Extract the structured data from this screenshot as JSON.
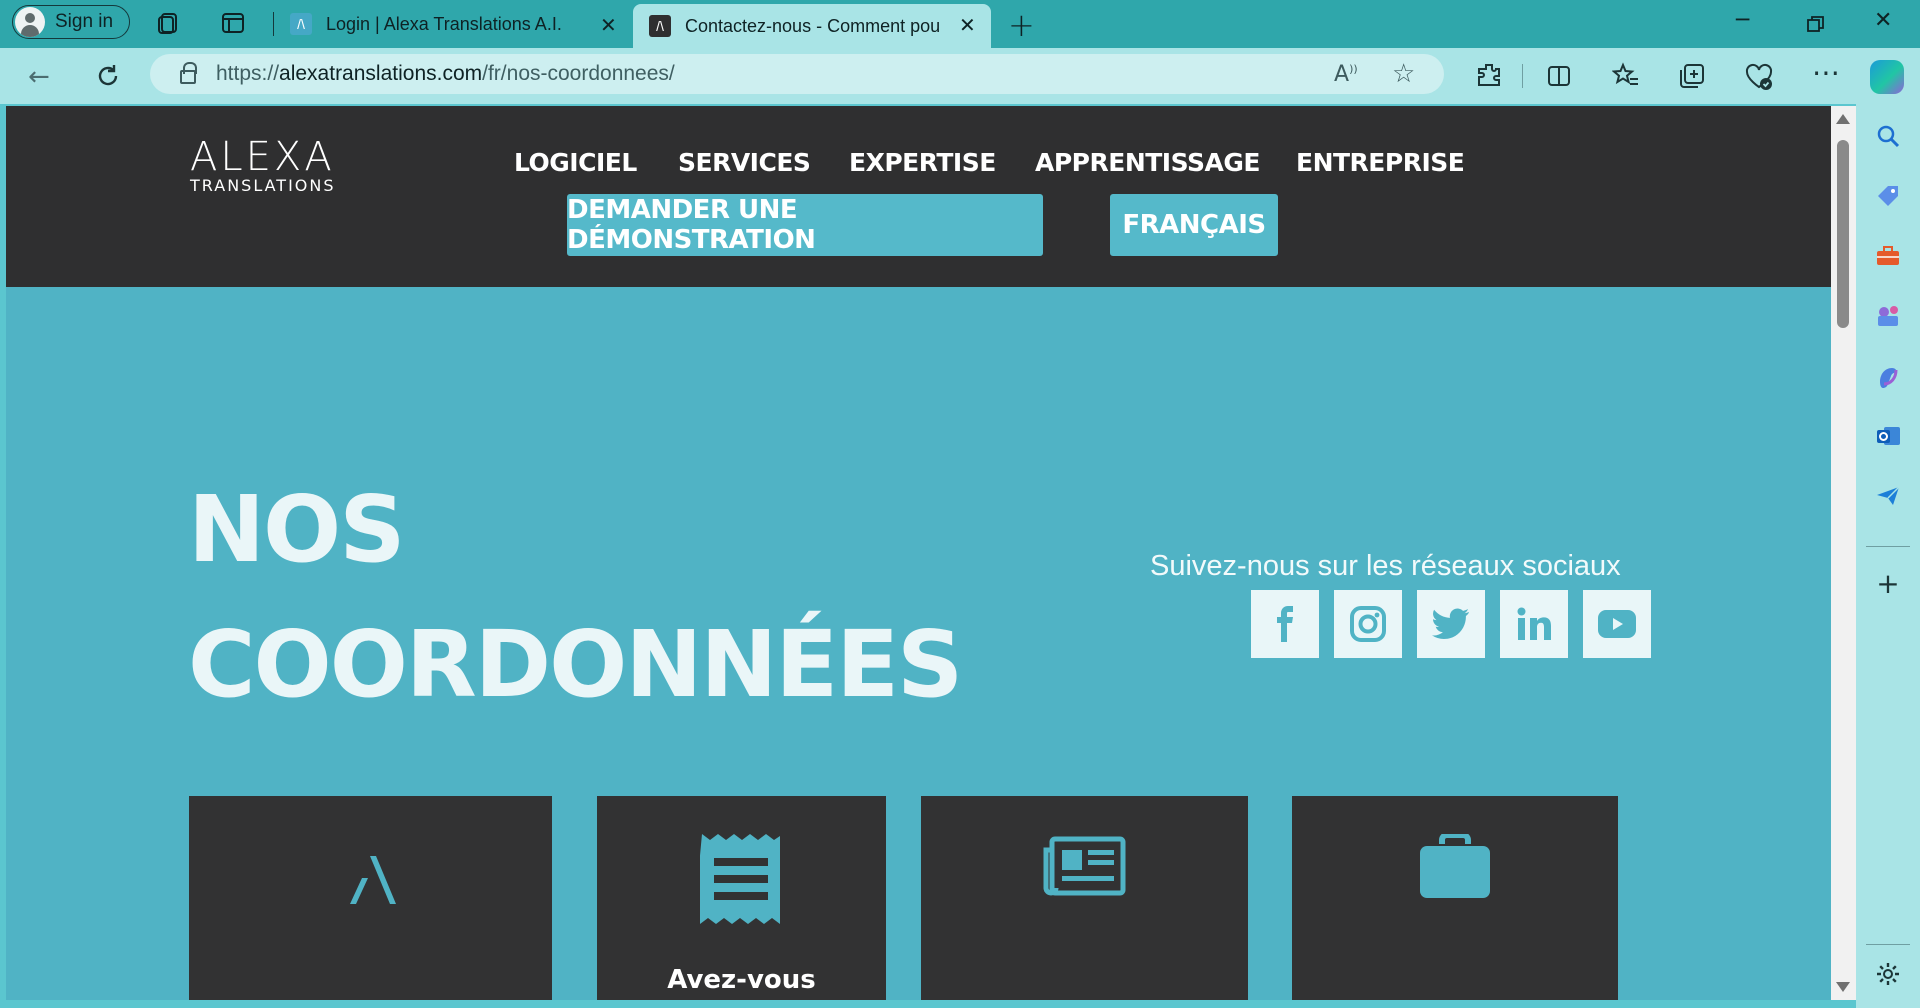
{
  "browser": {
    "signin_label": "Sign in",
    "tabs": [
      {
        "title": "Login | Alexa Translations A.I.",
        "favicon": "/\\",
        "active": false
      },
      {
        "title": "Contactez-nous - Comment pou",
        "favicon": "/\\",
        "active": true
      }
    ],
    "url_prefix": "https://",
    "url_domain": "alexatranslations.com",
    "url_path": "/fr/nos-coordonnees/",
    "accent_color": "#2fa7ab"
  },
  "site": {
    "logo_main": "ALEXA",
    "logo_sub": "TRANSLATIONS",
    "menu": [
      "LOGICIEL",
      "SERVICES",
      "EXPERTISE",
      "APPRENTISSAGE",
      "ENTREPRISE"
    ],
    "demo_button": "DEMANDER UNE DÉMONSTRATION",
    "language_button": "FRANÇAIS",
    "title_line1": "NOS",
    "title_line2": "COORDONNÉES",
    "social_heading": "Suivez-nous sur les réseaux sociaux",
    "social_icons": [
      "facebook-icon",
      "instagram-icon",
      "twitter-icon",
      "linkedin-icon",
      "youtube-icon"
    ],
    "cards": [
      {
        "icon": "alexa-logo-icon",
        "caption": ""
      },
      {
        "icon": "receipt-icon",
        "caption": "Avez-vous"
      },
      {
        "icon": "newspaper-icon",
        "caption": ""
      },
      {
        "icon": "briefcase-icon",
        "caption": ""
      }
    ],
    "colors": {
      "header": "#2f2f30",
      "hero": "#50b3c5",
      "button": "#55b9ca",
      "card": "#323233"
    }
  }
}
